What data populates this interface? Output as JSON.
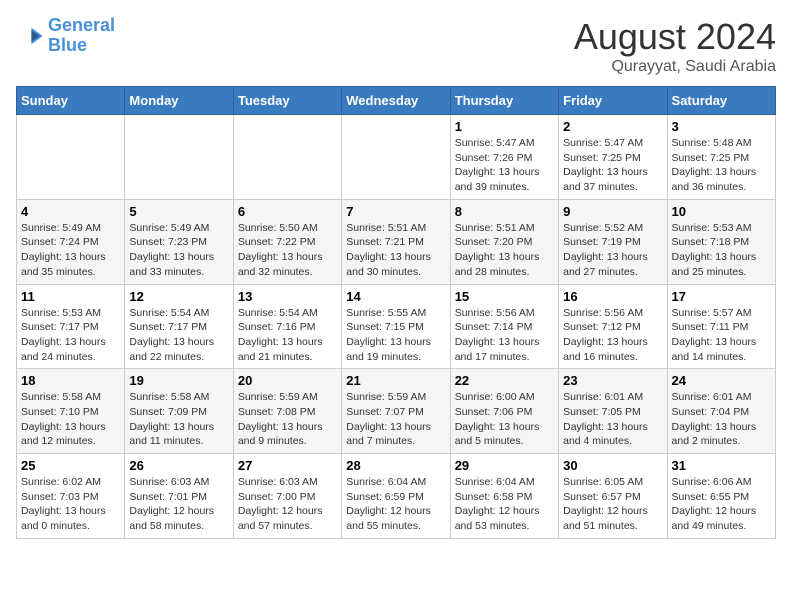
{
  "logo": {
    "line1": "General",
    "line2": "Blue"
  },
  "title": "August 2024",
  "subtitle": "Qurayyat, Saudi Arabia",
  "weekdays": [
    "Sunday",
    "Monday",
    "Tuesday",
    "Wednesday",
    "Thursday",
    "Friday",
    "Saturday"
  ],
  "weeks": [
    [
      {
        "day": "",
        "info": ""
      },
      {
        "day": "",
        "info": ""
      },
      {
        "day": "",
        "info": ""
      },
      {
        "day": "",
        "info": ""
      },
      {
        "day": "1",
        "info": "Sunrise: 5:47 AM\nSunset: 7:26 PM\nDaylight: 13 hours\nand 39 minutes."
      },
      {
        "day": "2",
        "info": "Sunrise: 5:47 AM\nSunset: 7:25 PM\nDaylight: 13 hours\nand 37 minutes."
      },
      {
        "day": "3",
        "info": "Sunrise: 5:48 AM\nSunset: 7:25 PM\nDaylight: 13 hours\nand 36 minutes."
      }
    ],
    [
      {
        "day": "4",
        "info": "Sunrise: 5:49 AM\nSunset: 7:24 PM\nDaylight: 13 hours\nand 35 minutes."
      },
      {
        "day": "5",
        "info": "Sunrise: 5:49 AM\nSunset: 7:23 PM\nDaylight: 13 hours\nand 33 minutes."
      },
      {
        "day": "6",
        "info": "Sunrise: 5:50 AM\nSunset: 7:22 PM\nDaylight: 13 hours\nand 32 minutes."
      },
      {
        "day": "7",
        "info": "Sunrise: 5:51 AM\nSunset: 7:21 PM\nDaylight: 13 hours\nand 30 minutes."
      },
      {
        "day": "8",
        "info": "Sunrise: 5:51 AM\nSunset: 7:20 PM\nDaylight: 13 hours\nand 28 minutes."
      },
      {
        "day": "9",
        "info": "Sunrise: 5:52 AM\nSunset: 7:19 PM\nDaylight: 13 hours\nand 27 minutes."
      },
      {
        "day": "10",
        "info": "Sunrise: 5:53 AM\nSunset: 7:18 PM\nDaylight: 13 hours\nand 25 minutes."
      }
    ],
    [
      {
        "day": "11",
        "info": "Sunrise: 5:53 AM\nSunset: 7:17 PM\nDaylight: 13 hours\nand 24 minutes."
      },
      {
        "day": "12",
        "info": "Sunrise: 5:54 AM\nSunset: 7:17 PM\nDaylight: 13 hours\nand 22 minutes."
      },
      {
        "day": "13",
        "info": "Sunrise: 5:54 AM\nSunset: 7:16 PM\nDaylight: 13 hours\nand 21 minutes."
      },
      {
        "day": "14",
        "info": "Sunrise: 5:55 AM\nSunset: 7:15 PM\nDaylight: 13 hours\nand 19 minutes."
      },
      {
        "day": "15",
        "info": "Sunrise: 5:56 AM\nSunset: 7:14 PM\nDaylight: 13 hours\nand 17 minutes."
      },
      {
        "day": "16",
        "info": "Sunrise: 5:56 AM\nSunset: 7:12 PM\nDaylight: 13 hours\nand 16 minutes."
      },
      {
        "day": "17",
        "info": "Sunrise: 5:57 AM\nSunset: 7:11 PM\nDaylight: 13 hours\nand 14 minutes."
      }
    ],
    [
      {
        "day": "18",
        "info": "Sunrise: 5:58 AM\nSunset: 7:10 PM\nDaylight: 13 hours\nand 12 minutes."
      },
      {
        "day": "19",
        "info": "Sunrise: 5:58 AM\nSunset: 7:09 PM\nDaylight: 13 hours\nand 11 minutes."
      },
      {
        "day": "20",
        "info": "Sunrise: 5:59 AM\nSunset: 7:08 PM\nDaylight: 13 hours\nand 9 minutes."
      },
      {
        "day": "21",
        "info": "Sunrise: 5:59 AM\nSunset: 7:07 PM\nDaylight: 13 hours\nand 7 minutes."
      },
      {
        "day": "22",
        "info": "Sunrise: 6:00 AM\nSunset: 7:06 PM\nDaylight: 13 hours\nand 5 minutes."
      },
      {
        "day": "23",
        "info": "Sunrise: 6:01 AM\nSunset: 7:05 PM\nDaylight: 13 hours\nand 4 minutes."
      },
      {
        "day": "24",
        "info": "Sunrise: 6:01 AM\nSunset: 7:04 PM\nDaylight: 13 hours\nand 2 minutes."
      }
    ],
    [
      {
        "day": "25",
        "info": "Sunrise: 6:02 AM\nSunset: 7:03 PM\nDaylight: 13 hours\nand 0 minutes."
      },
      {
        "day": "26",
        "info": "Sunrise: 6:03 AM\nSunset: 7:01 PM\nDaylight: 12 hours\nand 58 minutes."
      },
      {
        "day": "27",
        "info": "Sunrise: 6:03 AM\nSunset: 7:00 PM\nDaylight: 12 hours\nand 57 minutes."
      },
      {
        "day": "28",
        "info": "Sunrise: 6:04 AM\nSunset: 6:59 PM\nDaylight: 12 hours\nand 55 minutes."
      },
      {
        "day": "29",
        "info": "Sunrise: 6:04 AM\nSunset: 6:58 PM\nDaylight: 12 hours\nand 53 minutes."
      },
      {
        "day": "30",
        "info": "Sunrise: 6:05 AM\nSunset: 6:57 PM\nDaylight: 12 hours\nand 51 minutes."
      },
      {
        "day": "31",
        "info": "Sunrise: 6:06 AM\nSunset: 6:55 PM\nDaylight: 12 hours\nand 49 minutes."
      }
    ]
  ]
}
